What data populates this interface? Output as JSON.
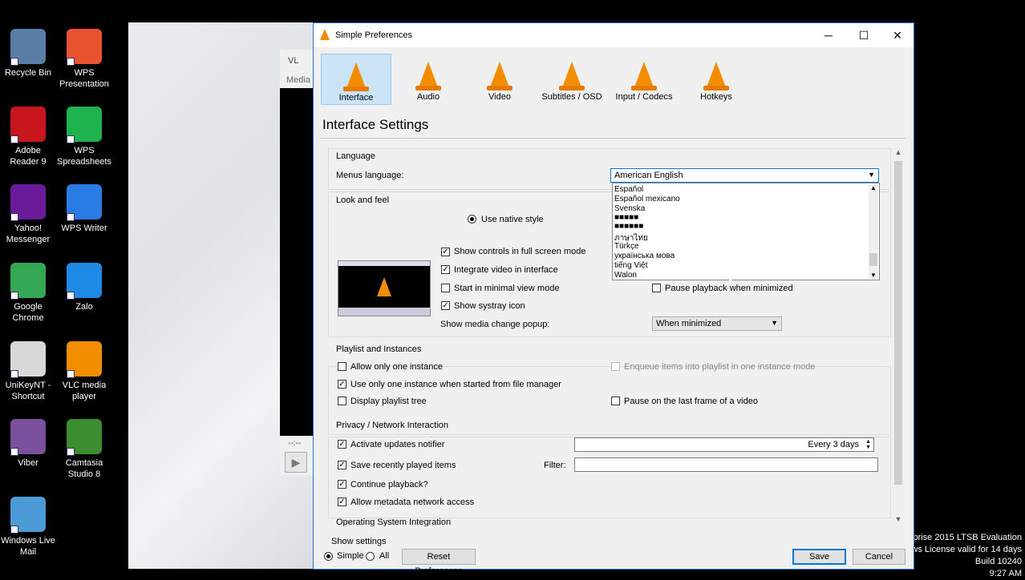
{
  "desktop": {
    "icons": [
      {
        "label": "Recycle Bin",
        "icon": "recycle-bin-icon",
        "color": "#5a7ea8"
      },
      {
        "label": "WPS Presentation",
        "icon": "wps-presentation-icon",
        "color": "#e8522e"
      },
      {
        "label": "Adobe Reader 9",
        "icon": "adobe-reader-icon",
        "color": "#c8161d"
      },
      {
        "label": "WPS Spreadsheets",
        "icon": "wps-spreadsheets-icon",
        "color": "#1fb34f"
      },
      {
        "label": "Yahoo! Messenger",
        "icon": "yahoo-messenger-icon",
        "color": "#6a1b9a"
      },
      {
        "label": "WPS Writer",
        "icon": "wps-writer-icon",
        "color": "#2a7be4"
      },
      {
        "label": "Google Chrome",
        "icon": "chrome-icon",
        "color": "#34a853"
      },
      {
        "label": "Zalo",
        "icon": "zalo-icon",
        "color": "#1e88e5"
      },
      {
        "label": "UniKeyNT - Shortcut",
        "icon": "unikey-icon",
        "color": "#d8d8d8"
      },
      {
        "label": "VLC media player",
        "icon": "vlc-icon",
        "color": "#f28d00"
      },
      {
        "label": "Viber",
        "icon": "viber-icon",
        "color": "#7b519d"
      },
      {
        "label": "Camtasia Studio 8",
        "icon": "camtasia-icon",
        "color": "#3c8d2f"
      },
      {
        "label": "Windows Live Mail",
        "icon": "live-mail-icon",
        "color": "#4c9ad6"
      }
    ],
    "background_window": {
      "title_fragment": "VL",
      "menu_fragment": "Media",
      "time": "--:--"
    },
    "watermark": [
      "rprise 2015 LTSB Evaluation",
      "ws License valid for 14 days",
      "Build 10240",
      "9:27 AM"
    ]
  },
  "dialog": {
    "title": "Simple Preferences",
    "window_buttons": {
      "minimize": "─",
      "maximize": "☐",
      "close": "✕"
    },
    "toolbar": [
      {
        "label": "Interface",
        "icon": "interface-icon",
        "active": true
      },
      {
        "label": "Audio",
        "icon": "audio-icon",
        "active": false
      },
      {
        "label": "Video",
        "icon": "video-icon",
        "active": false
      },
      {
        "label": "Subtitles / OSD",
        "icon": "subtitles-icon",
        "active": false
      },
      {
        "label": "Input / Codecs",
        "icon": "input-codecs-icon",
        "active": false
      },
      {
        "label": "Hotkeys",
        "icon": "hotkeys-icon",
        "active": false
      }
    ],
    "heading": "Interface Settings",
    "language": {
      "section": "Language",
      "menus_label": "Menus language:",
      "selected": "American English",
      "options": [
        "Español",
        "Español mexicano",
        "Svenska",
        "■■■■■",
        "■■■■■■",
        "ภาษาไทย",
        "Türkçe",
        "українська мова",
        "tiếng Việt",
        "Walon"
      ]
    },
    "look": {
      "section": "Look and feel",
      "native_style": "Use native style",
      "show_controls": "Show controls in full screen mode",
      "integrate_video": "Integrate video in interface",
      "minimal_view": "Start in minimal view mode",
      "systray": "Show systray icon",
      "pause_minimized": "Pause playback when minimized",
      "media_popup_label": "Show media change popup:",
      "media_popup_value": "When minimized"
    },
    "playlist": {
      "section": "Playlist and Instances",
      "one_instance": "Allow only one instance",
      "enqueue": "Enqueue items into playlist in one instance mode",
      "file_manager": "Use only one instance when started from file manager",
      "playlist_tree": "Display playlist tree",
      "pause_last": "Pause on the last frame of a video"
    },
    "privacy": {
      "section": "Privacy / Network Interaction",
      "updates": "Activate updates notifier",
      "updates_value": "Every 3 days",
      "recent": "Save recently played items",
      "filter_label": "Filter:",
      "continue": "Continue playback?",
      "metadata": "Allow metadata network access"
    },
    "os_section": "Operating System Integration",
    "footer": {
      "show_settings": "Show settings",
      "simple": "Simple",
      "all": "All",
      "reset": "Reset Preferences",
      "save": "Save",
      "cancel": "Cancel"
    }
  }
}
